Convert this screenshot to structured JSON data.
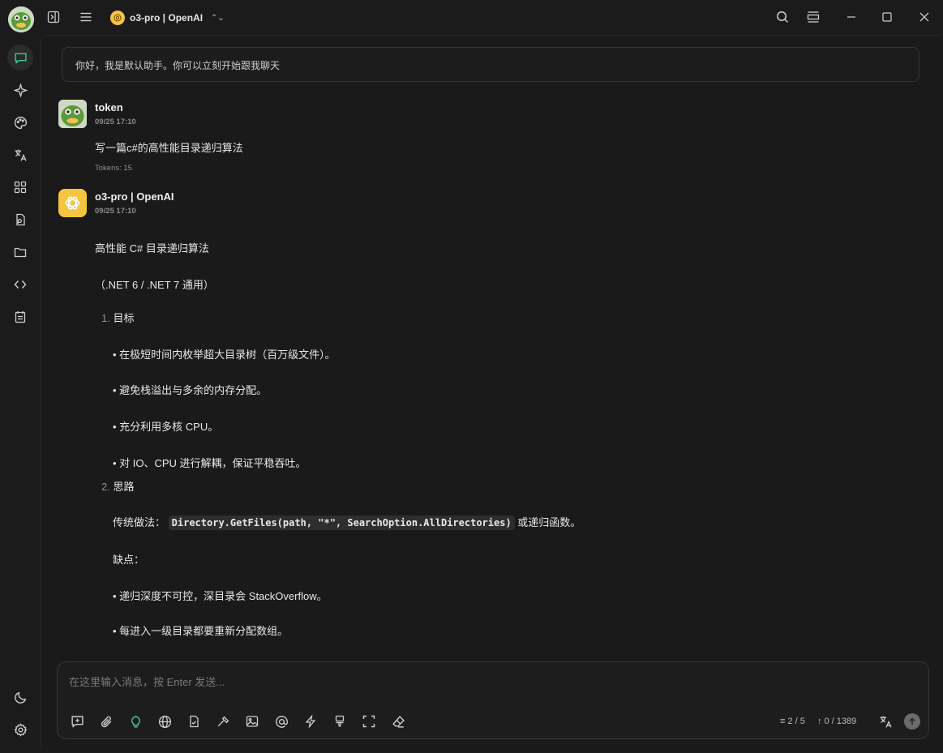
{
  "titlebar": {
    "model_name": "o3-pro | OpenAI"
  },
  "welcome": {
    "text": "你好，我是默认助手。你可以立刻开始跟我聊天"
  },
  "user_message": {
    "author": "token",
    "time": "09/25 17:10",
    "text": "写一篇c#的高性能目录递归算法",
    "tokens": "Tokens: 15"
  },
  "assistant_message": {
    "author": "o3-pro | OpenAI",
    "time": "09/25 17:10",
    "heading": "高性能 C# 目录递归算法",
    "subheading": "（.NET 6 / .NET 7 通用）",
    "section1_num": "1.",
    "section1_title": "目标",
    "goals": [
      "• 在极短时间内枚举超大目录树（百万级文件）。",
      "• 避免栈溢出与多余的内存分配。",
      "• 充分利用多核 CPU。",
      "• 对 IO、CPU 进行解耦，保证平稳吞吐。"
    ],
    "section2_num": "2.",
    "section2_title": "思路",
    "traditional_prefix": "传统做法：",
    "traditional_code": "Directory.GetFiles(path, \"*\", SearchOption.AllDirectories)",
    "traditional_suffix": "或递归函数。",
    "drawbacks_label": "缺点：",
    "drawbacks": [
      "• 递归深度不可控，深目录会 StackOverflow。",
      "• 每进入一级目录都要重新分配数组。"
    ]
  },
  "composer": {
    "placeholder": "在这里输入消息，按 Enter 发送...",
    "context_count": "2 / 5",
    "token_count": "0 / 1389"
  },
  "colors": {
    "accent": "#3ccf91",
    "background": "#1b1b1b",
    "openai_badge": "#f5c542"
  }
}
